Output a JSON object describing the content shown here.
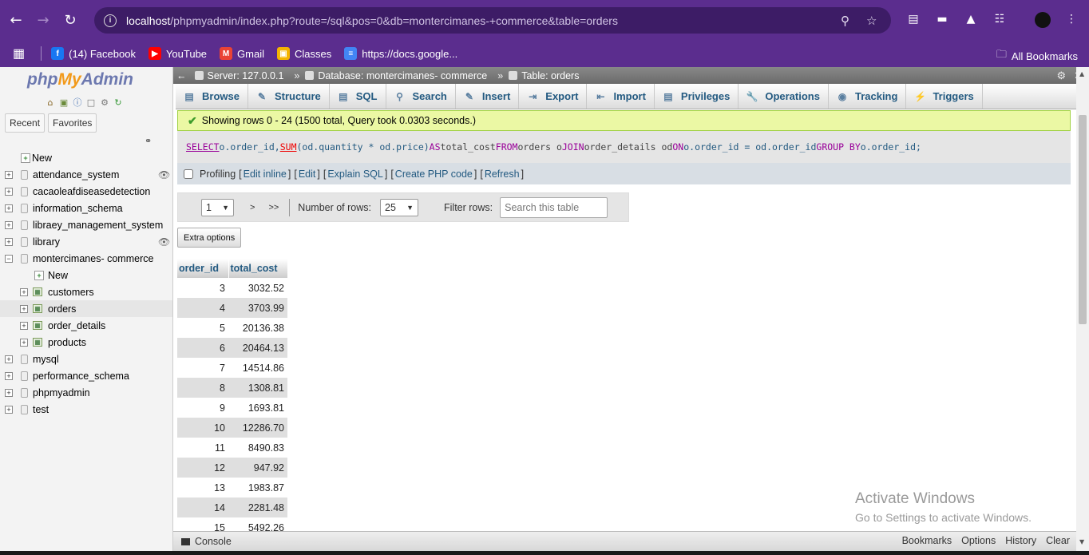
{
  "browser": {
    "url_host": "localhost",
    "url_rest": "/phpmyadmin/index.php?route=/sql&pos=0&db=montercimanes-+commerce&table=orders",
    "bookmarks": [
      {
        "label": "(14) Facebook",
        "icon": "facebook-icon",
        "color": "#1877f2"
      },
      {
        "label": "YouTube",
        "icon": "youtube-icon",
        "color": "#ff0000"
      },
      {
        "label": "Gmail",
        "icon": "gmail-icon",
        "color": "#ea4335"
      },
      {
        "label": "Classes",
        "icon": "classroom-icon",
        "color": "#f4b400"
      },
      {
        "label": "https://docs.google...",
        "icon": "docs-icon",
        "color": "#4285f4"
      }
    ],
    "all_bookmarks": "All Bookmarks"
  },
  "sidebar": {
    "logo": {
      "php": "php",
      "my": "My",
      "admin": "Admin"
    },
    "recent": "Recent",
    "favorites": "Favorites",
    "new": "New",
    "databases": [
      "attendance_system",
      "cacaoleafdiseasedetection",
      "information_schema",
      "libraey_management_system",
      "library",
      "montercimanes- commerce",
      "mysql",
      "performance_schema",
      "phpmyadmin",
      "test"
    ],
    "expanded_db": {
      "new": "New",
      "tables": [
        "customers",
        "orders",
        "order_details",
        "products"
      ]
    }
  },
  "breadcrumb": {
    "server": "Server: 127.0.0.1",
    "database": "Database: montercimanes- commerce",
    "table": "Table: orders"
  },
  "tabs": [
    "Browse",
    "Structure",
    "SQL",
    "Search",
    "Insert",
    "Export",
    "Import",
    "Privileges",
    "Operations",
    "Tracking",
    "Triggers"
  ],
  "message": "Showing rows 0 - 24 (1500 total, Query took 0.0303 seconds.)",
  "sql": {
    "select": "SELECT",
    "p1": " o.order_id, ",
    "sum": "SUM",
    "p2": "(od.quantity * od.price) ",
    "as": "AS",
    "p3": " total_cost ",
    "from": "FROM",
    "p4": " orders o ",
    "join": "JOIN",
    "p5": " order_details od ",
    "on": "ON",
    "p6": " o.order_id = od.order_id ",
    "group": "GROUP BY",
    "p7": " o.order_id;"
  },
  "profiling": {
    "label": "Profiling",
    "edit_inline": "Edit inline",
    "edit": "Edit",
    "explain": "Explain SQL",
    "create_php": "Create PHP code",
    "refresh": "Refresh"
  },
  "nav": {
    "page": "1",
    "next": ">",
    "last": ">>",
    "rows_label": "Number of rows:",
    "rows_value": "25",
    "filter_label": "Filter rows:",
    "filter_placeholder": "Search this table"
  },
  "extra_options": "Extra options",
  "results": {
    "columns": [
      "order_id",
      "total_cost"
    ],
    "rows": [
      [
        "3",
        "3032.52"
      ],
      [
        "4",
        "3703.99"
      ],
      [
        "5",
        "20136.38"
      ],
      [
        "6",
        "20464.13"
      ],
      [
        "7",
        "14514.86"
      ],
      [
        "8",
        "1308.81"
      ],
      [
        "9",
        "1693.81"
      ],
      [
        "10",
        "12286.70"
      ],
      [
        "11",
        "8490.83"
      ],
      [
        "12",
        "947.92"
      ],
      [
        "13",
        "1983.87"
      ],
      [
        "14",
        "2281.48"
      ],
      [
        "15",
        "5492.26"
      ]
    ]
  },
  "console": {
    "label": "Console",
    "links": [
      "Bookmarks",
      "Options",
      "History",
      "Clear"
    ]
  },
  "watermark": {
    "line1": "Activate Windows",
    "line2": "Go to Settings to activate Windows."
  }
}
